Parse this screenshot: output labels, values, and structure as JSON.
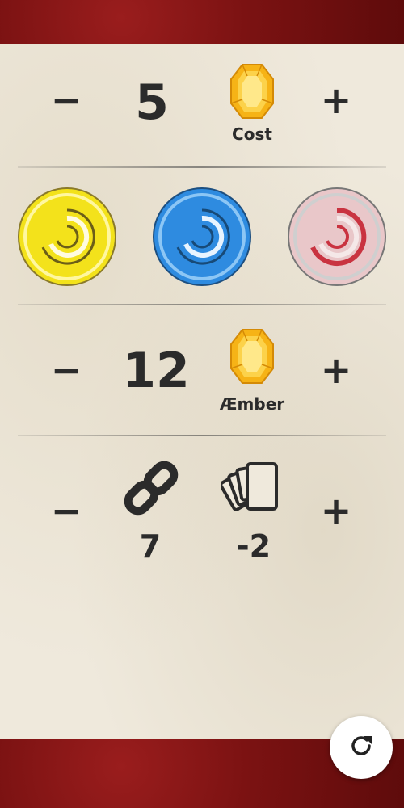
{
  "cost": {
    "minus_label": "−",
    "value": "5",
    "label": "Cost",
    "plus_label": "+"
  },
  "houses": [
    {
      "name": "yellow-house-icon",
      "color": "#f2e21a"
    },
    {
      "name": "blue-house-icon",
      "color": "#2f8de0"
    },
    {
      "name": "red-house-icon",
      "color": "#d55a63"
    }
  ],
  "amber": {
    "minus_label": "−",
    "value": "12",
    "label": "Æmber",
    "plus_label": "+"
  },
  "chain": {
    "minus_label": "−",
    "chains_value": "7",
    "cards_value": "-2",
    "plus_label": "+"
  },
  "refresh_icon": "refresh-icon"
}
